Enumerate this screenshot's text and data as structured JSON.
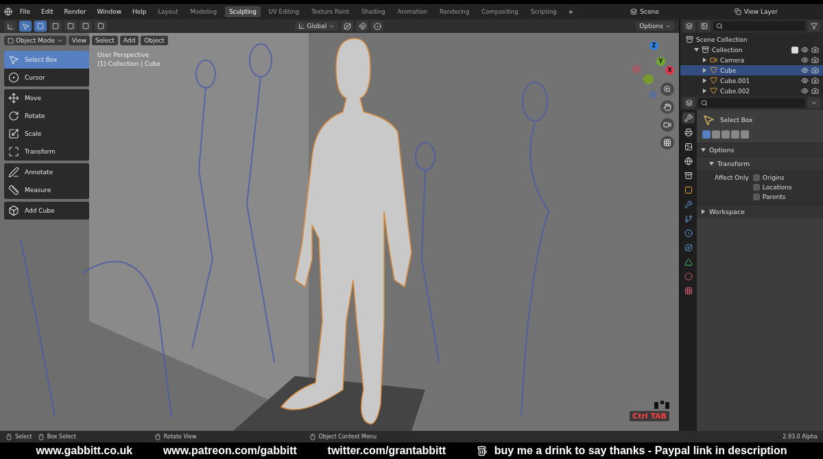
{
  "menu": [
    "File",
    "Edit",
    "Render",
    "Window",
    "Help"
  ],
  "workspaces": [
    {
      "label": "Layout",
      "selected": false
    },
    {
      "label": "Modeling",
      "selected": false
    },
    {
      "label": "Sculpting",
      "selected": true
    },
    {
      "label": "UV Editing",
      "selected": false
    },
    {
      "label": "Texture Paint",
      "selected": false
    },
    {
      "label": "Shading",
      "selected": false
    },
    {
      "label": "Animation",
      "selected": false
    },
    {
      "label": "Rendering",
      "selected": false
    },
    {
      "label": "Compositing",
      "selected": false
    },
    {
      "label": "Scripting",
      "selected": false
    }
  ],
  "add_workspace": "+",
  "scene": "Scene",
  "view_layer": "View Layer",
  "tool_header": {
    "orientation": "Global",
    "options": "Options"
  },
  "viewport_header": {
    "mode": "Object Mode",
    "menus": [
      "View",
      "Select",
      "Add",
      "Object"
    ]
  },
  "viewport": {
    "overlay_lines": [
      "User Perspective",
      "(1) Collection | Cube"
    ],
    "tool_groups": [
      [
        {
          "label": "Select Box",
          "selected": true
        },
        {
          "label": "Cursor",
          "selected": false
        }
      ],
      [
        {
          "label": "Move",
          "selected": false
        },
        {
          "label": "Rotate",
          "selected": false
        },
        {
          "label": "Scale",
          "selected": false
        },
        {
          "label": "Transform",
          "selected": false
        }
      ],
      [
        {
          "label": "Annotate",
          "selected": false
        },
        {
          "label": "Measure",
          "selected": false
        }
      ],
      [
        {
          "label": "Add Cube",
          "selected": false
        }
      ]
    ],
    "axes": [
      {
        "label": "Z",
        "color": "#2f83e0"
      },
      {
        "label": "Y",
        "color": "#6fa82a"
      },
      {
        "label": "X",
        "color": "#e0384f"
      }
    ],
    "hint": "Ctrl TAB"
  },
  "outliner": {
    "items": [
      {
        "label": "Scene Collection",
        "kind": "collection",
        "children": [
          {
            "label": "Collection",
            "kind": "collection",
            "expanded": true,
            "checked": true,
            "children": [
              {
                "label": "Camera",
                "kind": "camera",
                "expanded": false,
                "selected": false
              },
              {
                "label": "Cube",
                "kind": "mesh",
                "expanded": false,
                "selected": true
              },
              {
                "label": "Cube.001",
                "kind": "mesh",
                "expanded": false,
                "selected": false
              },
              {
                "label": "Cube.002",
                "kind": "mesh",
                "expanded": false,
                "selected": false
              }
            ]
          }
        ]
      }
    ]
  },
  "properties": {
    "tool": "Select Box",
    "panels": [
      {
        "label": "Options",
        "expanded": true,
        "subpanel": {
          "label": "Transform",
          "expanded": true,
          "field_label": "Affect Only",
          "options": [
            {
              "label": "Origins",
              "checked": false
            },
            {
              "label": "Locations",
              "checked": false
            },
            {
              "label": "Parents",
              "checked": false
            }
          ]
        }
      },
      {
        "label": "Workspace",
        "expanded": false
      }
    ]
  },
  "status_bar": {
    "items": [
      "Select",
      "Box Select",
      "Rotate View",
      "Object Context Menu"
    ],
    "version": "2.93.0 Alpha"
  },
  "banner": [
    "www.gabbitt.co.uk",
    "www.patreon.com/gabbitt",
    "twitter.com/grantabbitt",
    "buy me a drink to say thanks - Paypal link in description"
  ]
}
